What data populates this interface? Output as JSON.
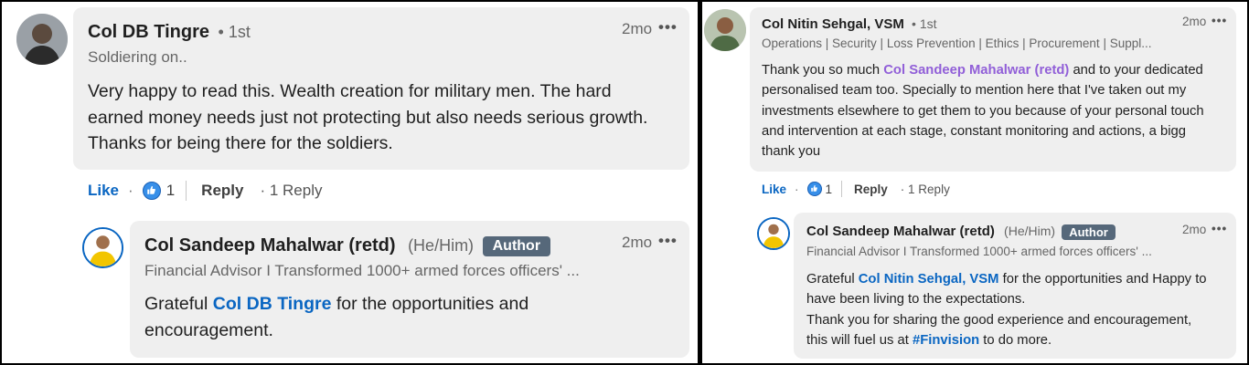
{
  "left": {
    "comment": {
      "author": "Col DB Tingre",
      "degree": "• 1st",
      "headline": "Soldiering on..",
      "time": "2mo",
      "body": "Very happy to read this. Wealth creation for military men. The hard earned money needs just not protecting but also needs serious growth. Thanks for being there for the soldiers."
    },
    "actions": {
      "like": "Like",
      "dot": "·",
      "reaction_count": "1",
      "reply": "Reply",
      "replies": "· 1 Reply"
    },
    "reply": {
      "author": "Col Sandeep Mahalwar (retd)",
      "pronouns": "(He/Him)",
      "badge": "Author",
      "headline": "Financial Advisor I Transformed 1000+ armed forces officers' ...",
      "time": "2mo",
      "body_pre": "Grateful ",
      "mention": "Col DB Tingre",
      "body_post": " for the opportunities and encouragement."
    }
  },
  "right": {
    "comment": {
      "author": "Col Nitin Sehgal, VSM",
      "degree": "• 1st",
      "headline": "Operations | Security | Loss Prevention | Ethics | Procurement | Suppl...",
      "time": "2mo",
      "body_pre": "Thank you so much ",
      "mention": "Col Sandeep Mahalwar (retd)",
      "body_post": " and to your dedicated personalised team too. Specially to mention here that I've taken out my investments elsewhere to get them to you because of your personal touch and intervention at each stage, constant monitoring and actions, a bigg thank you"
    },
    "actions": {
      "like": "Like",
      "dot": "·",
      "reaction_count": "1",
      "reply": "Reply",
      "replies": "· 1 Reply"
    },
    "reply": {
      "author": "Col Sandeep Mahalwar (retd)",
      "pronouns": "(He/Him)",
      "badge": "Author",
      "headline": "Financial Advisor I Transformed 1000+ armed forces officers' ...",
      "time": "2mo",
      "body_pre": "Grateful ",
      "mention": "Col Nitin Sehgal, VSM",
      "body_mid": " for the opportunities and Happy to have been living to the expectations.",
      "body_line3": "Thank you for sharing the good experience and encouragement, this will fuel us at ",
      "hashtag": "#Finvision",
      "body_post": " to do more."
    }
  },
  "colors": {
    "link_blue": "#0a66c2",
    "mention_purple": "#915fd8",
    "bubble_bg": "#efefef",
    "author_badge_bg": "#56687a",
    "muted_text": "#666666"
  },
  "icons": [
    "user-photo",
    "like-reaction-icon",
    "more-options-icon"
  ]
}
